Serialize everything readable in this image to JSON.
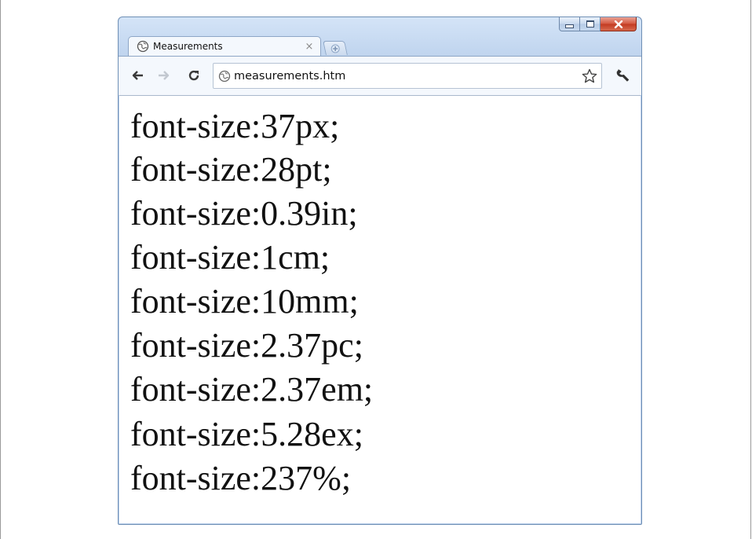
{
  "window": {
    "accent_color": "#c3d7f0",
    "close_color": "#c23a21"
  },
  "tab": {
    "title": "Measurements",
    "close_label": "×",
    "favicon": "globe-icon"
  },
  "new_tab": {
    "icon": "plus-icon"
  },
  "toolbar": {
    "back_icon": "back-arrow-icon",
    "forward_icon": "forward-arrow-icon",
    "reload_icon": "reload-icon",
    "url": "measurements.htm",
    "url_favicon": "globe-icon",
    "bookmark_icon": "star-icon",
    "menu_icon": "wrench-icon"
  },
  "content": {
    "lines": [
      "font-size:37px;",
      "font-size:28pt;",
      "font-size:0.39in;",
      "font-size:1cm;",
      "font-size:10mm;",
      "font-size:2.37pc;",
      "font-size:2.37em;",
      "font-size:5.28ex;",
      "font-size:237%;"
    ]
  }
}
